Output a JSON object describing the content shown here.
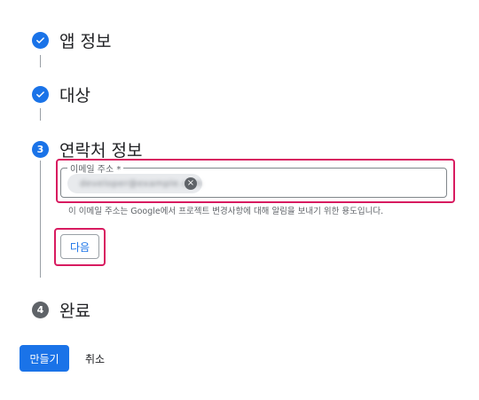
{
  "colors": {
    "accent": "#1a73e8",
    "highlight": "#d81b60",
    "step_inactive": "#5f6368"
  },
  "steps": [
    {
      "title": "앱 정보",
      "state": "completed",
      "icon": "check-icon"
    },
    {
      "title": "대상",
      "state": "completed",
      "icon": "check-icon"
    },
    {
      "title": "연락처 정보",
      "state": "active",
      "number": "3"
    },
    {
      "title": "완료",
      "state": "pending",
      "number": "4"
    }
  ],
  "contact": {
    "field_label": "이메일 주소 *",
    "chip_value": "developer@example.com",
    "remove_icon": "close-circle-icon",
    "helper_text": "이 이메일 주소는 Google에서 프로젝트 변경사항에 대해 알림을 보내기 위한 용도입니다."
  },
  "buttons": {
    "next": "다음",
    "create": "만들기",
    "cancel": "취소"
  }
}
